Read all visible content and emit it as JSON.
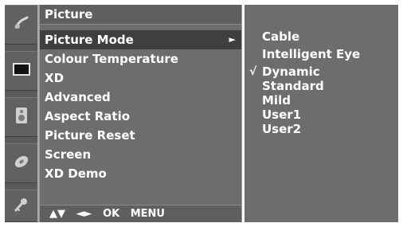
{
  "panel": {
    "title": "Picture"
  },
  "menu": {
    "items": [
      {
        "label": "Picture Mode",
        "has_submenu_arrow": true,
        "selected": true
      },
      {
        "label": "Colour Temperature"
      },
      {
        "label": "XD"
      },
      {
        "label": "Advanced"
      },
      {
        "label": "Aspect Ratio"
      },
      {
        "label": "Picture Reset"
      },
      {
        "label": "Screen"
      },
      {
        "label": "XD Demo"
      }
    ],
    "submenu_arrow_icon": "right-triangle"
  },
  "footer": {
    "nav_updown": "▲▼",
    "nav_leftright": "◄►",
    "ok": "OK",
    "menu": "MENU"
  },
  "submenu": {
    "items": [
      {
        "label": "Cable"
      },
      {
        "label": "Intelligent Eye"
      },
      {
        "label": "Dynamic",
        "checked": true,
        "check_icon": "√"
      },
      {
        "label": "Standard"
      },
      {
        "label": "Mild"
      },
      {
        "label": "User1"
      },
      {
        "label": "User2"
      }
    ]
  },
  "rail": {
    "icons": [
      "satellite-dish-icon",
      "picture-screen-icon",
      "speaker-icon",
      "disc-icon",
      "key-icon"
    ]
  },
  "colors": {
    "panel": "#6d6d6d",
    "rail": "#5b5b5b",
    "selected_row": "#3f3f3f",
    "text": "#ffffff",
    "divider": "#ffffff"
  }
}
